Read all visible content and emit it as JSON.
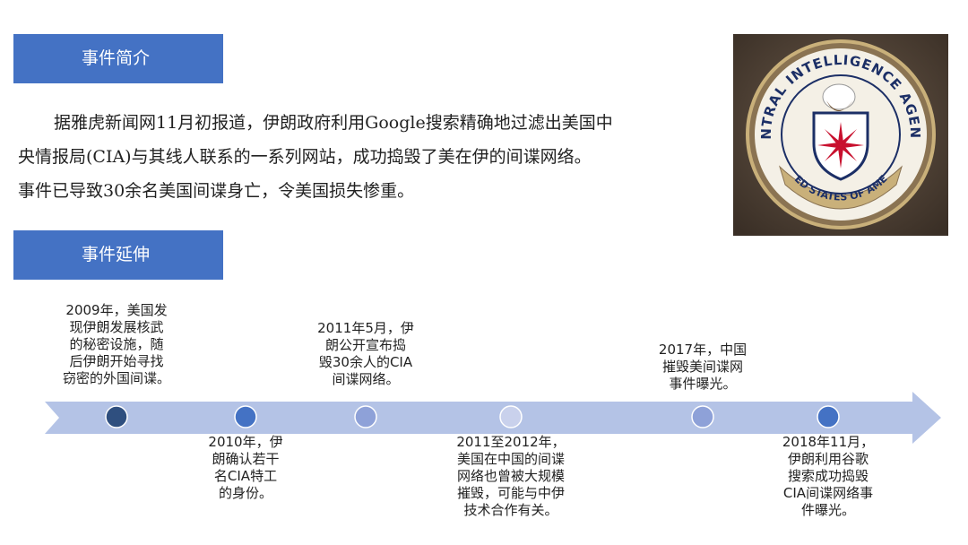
{
  "sections": {
    "intro_title": "事件简介",
    "extension_title": "事件延伸"
  },
  "intro": {
    "lines": [
      "据雅虎新闻网11月初报道，伊朗政府利用Google搜索精确地过滤出美国中",
      "央情报局(CIA)与其线人联系的一系列网站，成功捣毁了美在伊的间谍网络。",
      "事件已导致30余名美国间谍身亡，令美国损失惨重。"
    ]
  },
  "seal": {
    "top_text": "CENTRAL INTELLIGENCE AGENCY",
    "ribbon_text": "UNITED STATES OF AMERICA"
  },
  "timeline": {
    "events": [
      {
        "lines": [
          "2009年，美国发",
          "现伊朗发展核武",
          "的秘密设施，随",
          "后伊朗开始寻找",
          "窃密的外国间谍。"
        ],
        "fill": "#2f4f7f"
      },
      {
        "lines": [
          "2010年，伊",
          "朗确认若干",
          "名CIA特工",
          "的身份。"
        ],
        "fill": "#4472c4"
      },
      {
        "lines": [
          "2011年5月，伊",
          "朗公开宣布捣",
          "毁30余人的CIA",
          "间谍网络。"
        ],
        "fill": "#8ea1d8"
      },
      {
        "lines": [
          "2011至2012年，",
          "美国在中国的间谍",
          "网络也曾被大规模",
          "摧毁，可能与中伊",
          "技术合作有关。"
        ],
        "fill": "#c9d1ec"
      },
      {
        "lines": [
          "2017年，中国",
          "摧毁美间谍网",
          "事件曝光。"
        ],
        "fill": "#8ea1d8"
      },
      {
        "lines": [
          "2018年11月，",
          "伊朗利用谷歌",
          "搜索成功捣毁",
          "CIA间谍网络事",
          "件曝光。"
        ],
        "fill": "#4472c4"
      }
    ]
  },
  "colors": {
    "header_bg": "#4472c4",
    "arrow": "#b4c3e6"
  }
}
